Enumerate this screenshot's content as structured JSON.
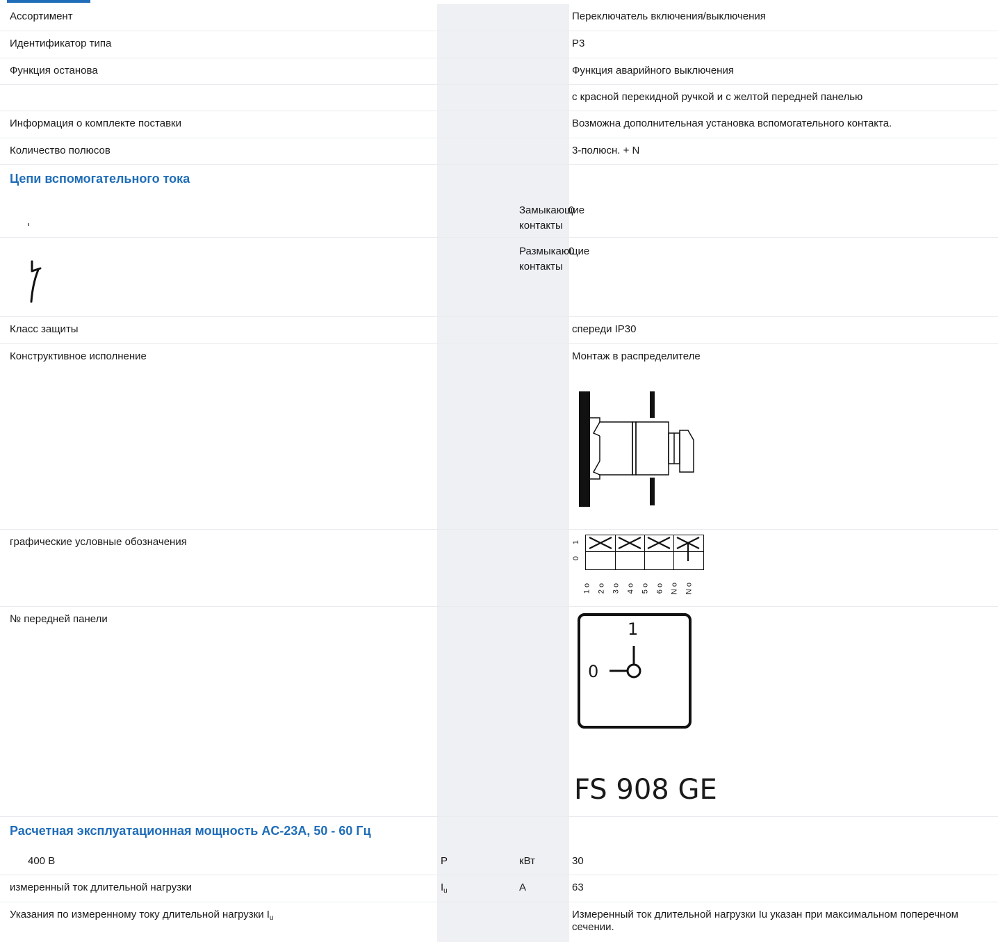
{
  "rows": {
    "assortment": {
      "label": "Ассортимент",
      "value": "Переключатель включения/выключения"
    },
    "type_id": {
      "label": "Идентификатор типа",
      "value": "P3"
    },
    "stop_function": {
      "label": "Функция останова",
      "value": "Функция аварийного выключения"
    },
    "stop_function_detail": {
      "value": "с красной перекидной ручкой и с желтой передней панелью"
    },
    "delivery_info": {
      "label": "Информация о комплекте поставки",
      "value": "Возможна дополнительная установка вспомогательного контакта."
    },
    "poles": {
      "label": "Количество полюсов",
      "value": "3-полюсн. + N"
    },
    "protection": {
      "label": "Класс защиты",
      "value": "спереди IP30"
    },
    "design": {
      "label": "Конструктивное исполнение",
      "value": "Монтаж в распределителе"
    },
    "symbols": {
      "label": "графические условные обозначения"
    },
    "front_plate": {
      "label": "№ передней панели",
      "code": "FS 908 GE",
      "pos_0": "0",
      "pos_1": "1"
    },
    "power_400": {
      "label": "400 В",
      "symbol": "P",
      "unit": "кВт",
      "value": "30"
    },
    "current": {
      "label": "измеренный ток длительной нагрузки",
      "symbol_main": "I",
      "symbol_sub": "u",
      "unit": "A",
      "value": "63"
    },
    "current_note": {
      "label_main": "Указания по измеренному току длительной нагрузки I",
      "label_sub": "u",
      "value": "Измеренный ток длительной нагрузки Iu указан при максимальном поперечном сечении."
    }
  },
  "sections": {
    "aux": "Цепи вспомогательного тока",
    "power": "Расчетная эксплуатационная мощность AC-23A, 50 - 60 Гц"
  },
  "contacts": {
    "no_label": "Замыкающие контакты",
    "no_value": "0",
    "nc_label": "Размыкающие контакты",
    "nc_value": "0"
  },
  "diagram": {
    "row_labels": [
      "1",
      "0"
    ],
    "terminals": [
      "1 o",
      "2 o",
      "3 o",
      "4 o",
      "5 o",
      "6 o",
      "N o",
      "N o"
    ]
  }
}
